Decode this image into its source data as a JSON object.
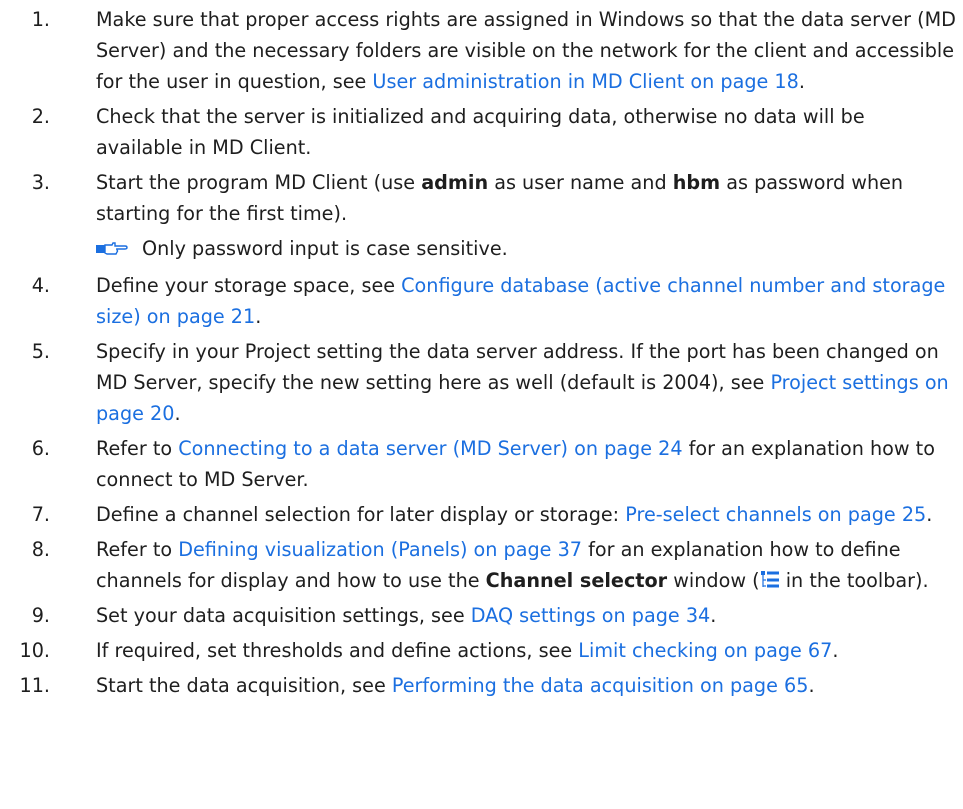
{
  "steps": [
    {
      "num": "1.",
      "pre": "Make sure that proper access rights are assigned in Windows so that the data server (MD Server) and the necessary folders are visible on the network for the cli­ent and accessible for the user in question, see ",
      "link": "User administration in MD Client on page 18",
      "post": "."
    },
    {
      "num": "2.",
      "text": "Check that the server is initialized and acquiring data, otherwise no data will be available in MD Client."
    },
    {
      "num": "3.",
      "pre": "Start the program MD Client (use ",
      "bold1": "admin",
      "mid": " as user name and ",
      "bold2": "hbm",
      "post": " as password when starting for the first time).",
      "note": "Only password input is case sensitive."
    },
    {
      "num": "4.",
      "pre": "Define your storage space, see ",
      "link": "Configure database (active channel number and storage size) on page 21",
      "post": "."
    },
    {
      "num": "5.",
      "pre": "Specify in your Project setting the data server address. If the port has been changed on MD Server, specify the new setting here as well (default is 2004), see ",
      "link": "Project settings on page 20",
      "post": "."
    },
    {
      "num": "6.",
      "pre": "Refer to ",
      "link": "Connecting to a data server (MD Server) on page 24",
      "post": " for an explanation how to connect to MD Server."
    },
    {
      "num": "7.",
      "pre": "Define a channel selection for later display or storage: ",
      "link": "Pre-select channels on page 25",
      "post": "."
    },
    {
      "num": "8.",
      "pre": "Refer to ",
      "link": "Defining visualization (Panels) on page 37",
      "mid": " for an explanation how to define channels for display and how to use the ",
      "bold1": "Channel selector",
      "mid2": " window (",
      "post": " in the toolbar)."
    },
    {
      "num": "9.",
      "pre": "Set your data acquisition settings, see ",
      "link": "DAQ settings on page 34",
      "post": "."
    },
    {
      "num": "10.",
      "pre": "If required, set thresholds and define actions, see ",
      "link": "Limit checking on page 67",
      "post": "."
    },
    {
      "num": "11.",
      "pre": "Start the data acquisition, see ",
      "link": "Performing the data acquisition on page 65",
      "post": "."
    }
  ],
  "icons": {
    "note_icon": "pointing-hand-icon",
    "toolbar_icon": "channel-selector-icon"
  },
  "colors": {
    "link": "#1b6fe0",
    "text": "#1e1e1e",
    "note_icon": "#1b6fe0"
  }
}
